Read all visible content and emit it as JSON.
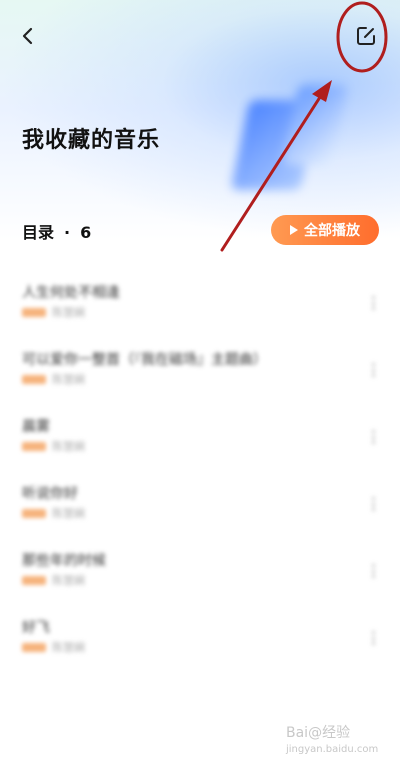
{
  "header": {
    "title": "我收藏的音乐",
    "back_icon": "chevron-left-icon",
    "edit_icon": "edit-square-icon"
  },
  "catalog": {
    "label": "目录",
    "separator": "·",
    "count": "6"
  },
  "play_all": {
    "label": "全部播放",
    "icon": "play-icon"
  },
  "songs": [
    {
      "title": "人生何处不相逢",
      "artist": "陈慧娴"
    },
    {
      "title": "可以爱你一整首（『我在磁场』主题曲）",
      "artist": "陈慧娴"
    },
    {
      "title": "晨雾",
      "artist": "陈慧娴"
    },
    {
      "title": "听说你好",
      "artist": "陈慧娴"
    },
    {
      "title": "那些年的时候",
      "artist": "陈慧娴"
    },
    {
      "title": "好飞",
      "artist": "陈慧娴"
    }
  ],
  "watermark": {
    "text": "Bai@经验",
    "sub": "jingyan.baidu.com"
  },
  "colors": {
    "accent_start": "#ff9a52",
    "accent_end": "#ff6d2d",
    "annotation": "#b01e1e"
  }
}
